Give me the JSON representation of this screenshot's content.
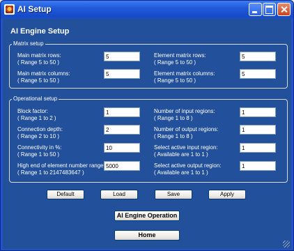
{
  "window": {
    "title": "AI Setup",
    "heading": "AI Engine Setup"
  },
  "matrix_setup": {
    "legend": "Matrix setup",
    "main_rows": {
      "label": "Main matrix rows:",
      "range": "( Range  5 to  50 )",
      "value": "5"
    },
    "main_cols": {
      "label": "Main matrix columns:",
      "range": "( Range  5 to  50 )",
      "value": "5"
    },
    "elem_rows": {
      "label": "Element matrix rows:",
      "range": "( Range  5 to  50 )",
      "value": "5"
    },
    "elem_cols": {
      "label": "Element matrix columns:",
      "range": "( Range  5 to  50 )",
      "value": "5"
    }
  },
  "operational_setup": {
    "legend": "Operational setup",
    "block_factor": {
      "label": "Block factor:",
      "range": "( Range  1 to  2 )",
      "value": "1"
    },
    "connection_depth": {
      "label": "Connection depth:",
      "range": "( Range  2 to  10 )",
      "value": "2"
    },
    "connectivity": {
      "label": "Connectivity in %:",
      "range": "( Range  1 to  50 )",
      "value": "10"
    },
    "high_end": {
      "label": "High end of element number range:",
      "range": "( Range  1 to  2147483647 )",
      "value": "5000"
    },
    "input_regions": {
      "label": "Number of input regions:",
      "range": "( Range  1 to  8 )",
      "value": "1"
    },
    "output_regions": {
      "label": "Number of output regions:",
      "range": "( Range  1 to  8 )",
      "value": "1"
    },
    "active_input": {
      "label": "Select active input region:",
      "range": "( Available are  1 to  1 )",
      "value": "1"
    },
    "active_output": {
      "label": "Select active output region:",
      "range": "( Available are  1 to  1 )",
      "value": "1"
    }
  },
  "buttons": {
    "default": "Default",
    "load": "Load",
    "save": "Save",
    "apply": "Apply",
    "ai_engine_operation": "AI Engine Operation",
    "home": "Home"
  },
  "icons": {
    "app": "app-icon",
    "minimize": "minimize-icon",
    "maximize": "maximize-icon",
    "close": "close-icon"
  },
  "colors": {
    "titlebar": "#1f5bd8",
    "client_background": "#22509a",
    "close_button": "#c9431e"
  }
}
